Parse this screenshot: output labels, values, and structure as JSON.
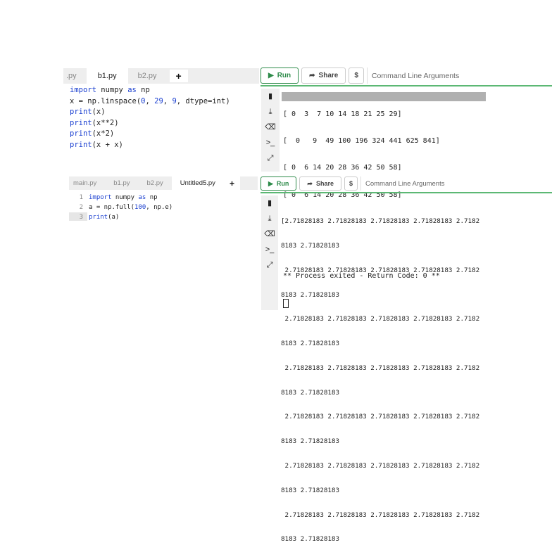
{
  "top": {
    "tabs": [
      ".py",
      "b1.py",
      "b2.py"
    ],
    "active_tab": "b1.py",
    "plus": "+",
    "code": [
      "import numpy as np",
      "x = np.linspace(0, 29, 9, dtype=int)",
      "print(x)",
      "print(x**2)",
      "print(x*2)",
      "print(x + x)"
    ],
    "toolbar": {
      "run": "Run",
      "share": "Share",
      "dollar": "$",
      "args_placeholder": "Command Line Arguments"
    },
    "output": [
      "[ 0  3  7 10 14 18 21 25 29]",
      "[  0   9  49 100 196 324 441 625 841]",
      "[ 0  6 14 20 28 36 42 50 58]",
      "[ 0  6 14 20 28 36 42 50 58]",
      "",
      "",
      "** Process exited - Return Code: 0 **"
    ]
  },
  "bottom": {
    "tabs": [
      "main.py",
      "b1.py",
      "b2.py",
      "Untitled5.py"
    ],
    "active_tab": "Untitled5.py",
    "plus": "+",
    "line_numbers": [
      "1",
      "2",
      "3"
    ],
    "code": [
      "import numpy as np",
      "a = np.full(100, np.e)",
      "print(a)"
    ],
    "toolbar": {
      "run": "Run",
      "share": "Share",
      "dollar": "$",
      "args_placeholder": "Command Line Arguments"
    },
    "output": [
      "[2.71828183 2.71828183 2.71828183 2.71828183 2.7182",
      "8183 2.71828183",
      " 2.71828183 2.71828183 2.71828183 2.71828183 2.7182",
      "8183 2.71828183",
      " 2.71828183 2.71828183 2.71828183 2.71828183 2.7182",
      "8183 2.71828183",
      " 2.71828183 2.71828183 2.71828183 2.71828183 2.7182",
      "8183 2.71828183",
      " 2.71828183 2.71828183 2.71828183 2.71828183 2.7182",
      "8183 2.71828183",
      " 2.71828183 2.71828183 2.71828183 2.71828183 2.7182",
      "8183 2.71828183",
      " 2.71828183 2.71828183 2.71828183 2.71828183 2.7182",
      "8183 2.71828183"
    ]
  }
}
